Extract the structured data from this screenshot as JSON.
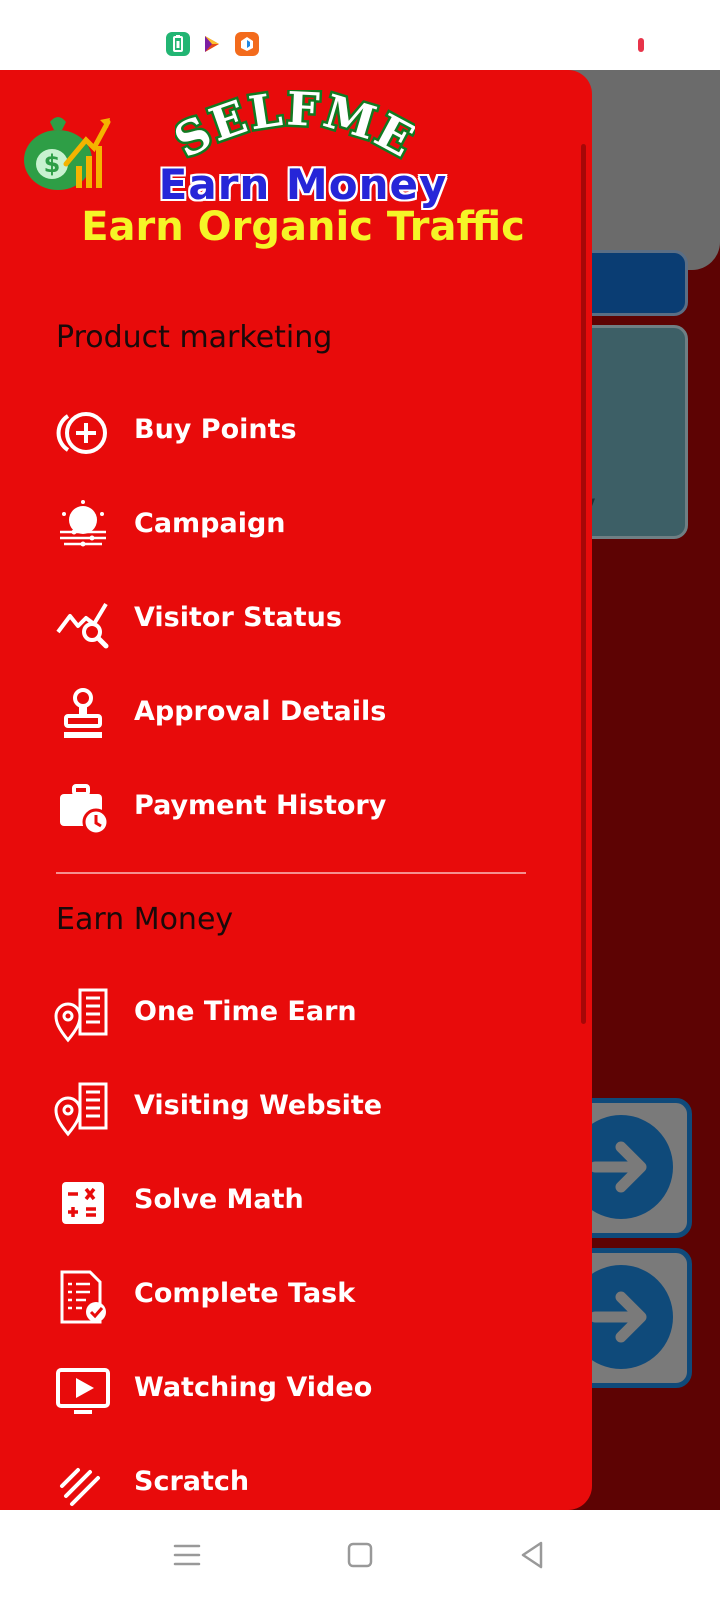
{
  "status_bar": {
    "icons": [
      "battery-saver-icon",
      "play-store-icon",
      "app-notification-icon"
    ],
    "indicator": "recording-dot-icon"
  },
  "background_app": {
    "partial_text": "y"
  },
  "banner": {
    "brand": "SELFME",
    "line1": "Earn Money",
    "line2": "Earn Organic Traffic",
    "colors": {
      "brand_fill": "#ffffff",
      "brand_stroke": "#117a21",
      "line1": "#2626d8",
      "line2": "#f5f527"
    }
  },
  "drawer": {
    "background": "#e80b0b",
    "sections": [
      {
        "title": "Product marketing",
        "items": [
          {
            "label": "Buy Points",
            "icon": "add-coin-icon"
          },
          {
            "label": "Campaign",
            "icon": "sunrise-campaign-icon"
          },
          {
            "label": "Visitor Status",
            "icon": "chart-search-icon"
          },
          {
            "label": "Approval Details",
            "icon": "stamp-icon"
          },
          {
            "label": "Payment History",
            "icon": "briefcase-clock-icon"
          }
        ]
      },
      {
        "title": "Earn Money",
        "items": [
          {
            "label": "One Time Earn",
            "icon": "building-location-icon"
          },
          {
            "label": "Visiting Website",
            "icon": "building-location-icon"
          },
          {
            "label": "Solve Math",
            "icon": "calculator-icon"
          },
          {
            "label": "Complete Task",
            "icon": "task-document-icon"
          },
          {
            "label": "Watching Video",
            "icon": "video-play-icon"
          },
          {
            "label": "Scratch",
            "icon": "scratch-icon"
          }
        ]
      }
    ]
  },
  "nav_bar": {
    "buttons": [
      "menu-icon",
      "home-icon",
      "back-icon"
    ]
  }
}
